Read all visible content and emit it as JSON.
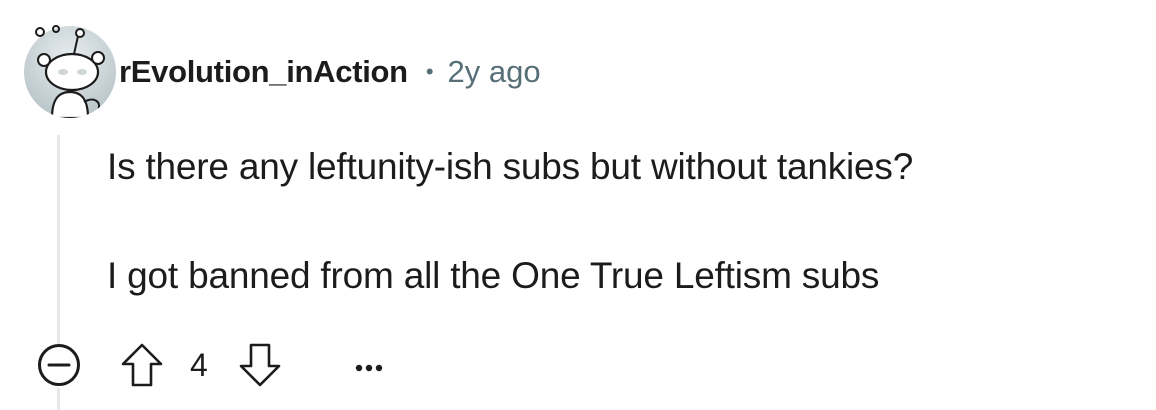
{
  "comment": {
    "author": "rEvolution_inAction",
    "separator": "•",
    "timestamp": "2y ago",
    "body_lines": [
      "Is there any leftunity-ish subs but without tankies?",
      "I got banned from all the One True Leftism subs"
    ],
    "score": "4"
  },
  "icons": {
    "avatar": "snoo-avatar",
    "collapse": "collapse-minus-icon",
    "upvote": "upvote-arrow-icon",
    "downvote": "downvote-arrow-icon",
    "more": "more-options-icon"
  },
  "colors": {
    "text": "#1c1c1c",
    "meta": "#576f76",
    "thread_line": "#e5e7e8",
    "avatar_bg": "#c8d0d3"
  }
}
